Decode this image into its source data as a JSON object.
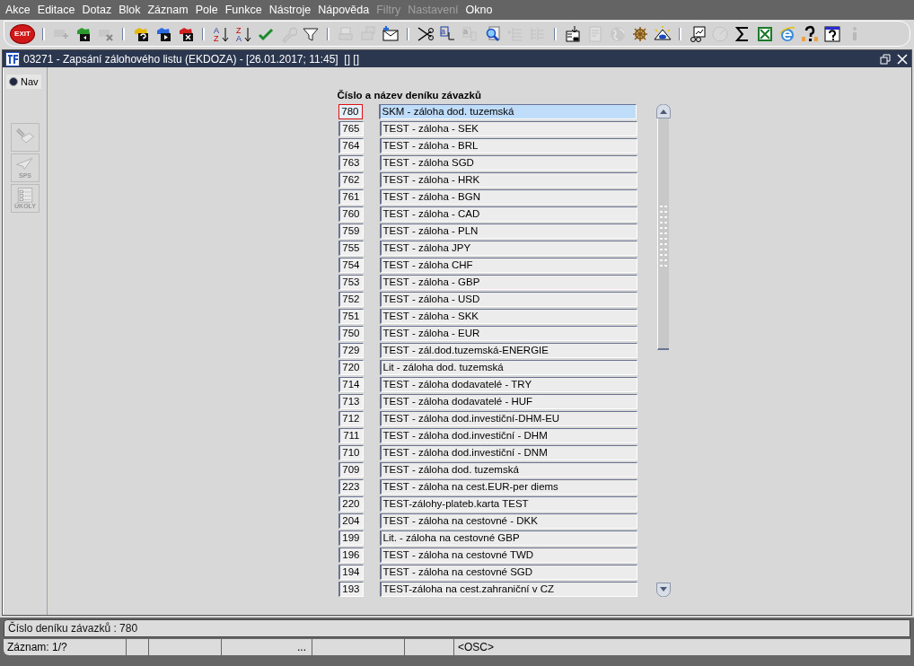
{
  "menu": [
    {
      "label": "Akce",
      "disabled": false
    },
    {
      "label": "Editace",
      "disabled": false
    },
    {
      "label": "Dotaz",
      "disabled": false
    },
    {
      "label": "Blok",
      "disabled": false
    },
    {
      "label": "Záznam",
      "disabled": false
    },
    {
      "label": "Pole",
      "disabled": false
    },
    {
      "label": "Funkce",
      "disabled": false
    },
    {
      "label": "Nástroje",
      "disabled": false
    },
    {
      "label": "Nápověda",
      "disabled": false
    },
    {
      "label": "Filtry",
      "disabled": true
    },
    {
      "label": "Nastavení",
      "disabled": true
    },
    {
      "label": "Okno",
      "disabled": false
    }
  ],
  "toolbar": [
    {
      "kind": "button",
      "disabled": false,
      "label": "EXIT"
    },
    {
      "kind": "separator"
    },
    {
      "kind": "button",
      "disabled": true
    },
    {
      "kind": "button",
      "disabled": false
    },
    {
      "kind": "button",
      "disabled": true
    },
    {
      "kind": "separator"
    },
    {
      "kind": "button",
      "disabled": false
    },
    {
      "kind": "button",
      "disabled": false
    },
    {
      "kind": "button",
      "disabled": false
    },
    {
      "kind": "separator"
    },
    {
      "kind": "button",
      "disabled": false,
      "letters": [
        "A",
        "Z"
      ]
    },
    {
      "kind": "button",
      "disabled": false,
      "letters": [
        "Z",
        "A"
      ]
    },
    {
      "kind": "button",
      "disabled": false
    },
    {
      "kind": "button",
      "disabled": true
    },
    {
      "kind": "button",
      "disabled": false
    },
    {
      "kind": "separator"
    },
    {
      "kind": "button",
      "disabled": true
    },
    {
      "kind": "button",
      "disabled": true
    },
    {
      "kind": "button",
      "disabled": false
    },
    {
      "kind": "separator"
    },
    {
      "kind": "button",
      "disabled": false
    },
    {
      "kind": "button",
      "disabled": false,
      "letters": [
        "a"
      ]
    },
    {
      "kind": "button",
      "disabled": true,
      "letters": [
        "a"
      ]
    },
    {
      "kind": "button",
      "disabled": false
    },
    {
      "kind": "button",
      "disabled": true
    },
    {
      "kind": "button",
      "disabled": true
    },
    {
      "kind": "separator"
    },
    {
      "kind": "button",
      "disabled": false
    },
    {
      "kind": "button",
      "disabled": true
    },
    {
      "kind": "button",
      "disabled": true
    },
    {
      "kind": "button",
      "disabled": false
    },
    {
      "kind": "button",
      "disabled": false
    },
    {
      "kind": "separator"
    },
    {
      "kind": "button",
      "disabled": false
    },
    {
      "kind": "button",
      "disabled": true
    },
    {
      "kind": "button",
      "disabled": false
    },
    {
      "kind": "button",
      "disabled": false
    },
    {
      "kind": "button",
      "disabled": false
    },
    {
      "kind": "button",
      "disabled": false
    },
    {
      "kind": "button",
      "disabled": false
    },
    {
      "kind": "button",
      "disabled": true
    }
  ],
  "window": {
    "title": "03271 - Zapsání zálohového listu (EKDOZA) - [26.01.2017; 11:45]  [] []"
  },
  "sidebar": {
    "radio": {
      "label": "Nav",
      "selected": true
    },
    "buttons": [
      {
        "disabled": true
      },
      {
        "label": "SPS",
        "disabled": true
      },
      {
        "label": "ÚKOLY",
        "disabled": true
      }
    ]
  },
  "table": {
    "heading": "Číslo a název deníku závazků",
    "rows": [
      {
        "number": "780",
        "name": "SKM - záloha dod. tuzemská",
        "selected": true
      },
      {
        "number": "765",
        "name": "TEST - záloha - SEK",
        "selected": false
      },
      {
        "number": "764",
        "name": "TEST - záloha - BRL",
        "selected": false
      },
      {
        "number": "763",
        "name": "TEST - záloha SGD",
        "selected": false
      },
      {
        "number": "762",
        "name": "TEST - záloha - HRK",
        "selected": false
      },
      {
        "number": "761",
        "name": "TEST - záloha - BGN",
        "selected": false
      },
      {
        "number": "760",
        "name": "TEST - záloha - CAD",
        "selected": false
      },
      {
        "number": "759",
        "name": "TEST - záloha - PLN",
        "selected": false
      },
      {
        "number": "755",
        "name": "TEST - záloha JPY",
        "selected": false
      },
      {
        "number": "754",
        "name": "TEST - záloha CHF",
        "selected": false
      },
      {
        "number": "753",
        "name": "TEST - záloha - GBP",
        "selected": false
      },
      {
        "number": "752",
        "name": "TEST - záloha - USD",
        "selected": false
      },
      {
        "number": "751",
        "name": "TEST - záloha - SKK",
        "selected": false
      },
      {
        "number": "750",
        "name": "TEST - záloha - EUR",
        "selected": false
      },
      {
        "number": "729",
        "name": "TEST - zál.dod.tuzemská-ENERGIE",
        "selected": false
      },
      {
        "number": "720",
        "name": "Lit - záloha dod. tuzemská",
        "selected": false
      },
      {
        "number": "714",
        "name": "TEST - záloha dodavatelé - TRY",
        "selected": false
      },
      {
        "number": "713",
        "name": "TEST - záloha dodavatelé - HUF",
        "selected": false
      },
      {
        "number": "712",
        "name": "TEST - záloha dod.investiční-DHM-EU",
        "selected": false
      },
      {
        "number": "711",
        "name": "TEST - záloha dod.investiční - DHM",
        "selected": false
      },
      {
        "number": "710",
        "name": "TEST - záloha dod.investiční - DNM",
        "selected": false
      },
      {
        "number": "709",
        "name": "TEST - záloha dod. tuzemská",
        "selected": false
      },
      {
        "number": "223",
        "name": "TEST - záloha na cest.EUR-per diems",
        "selected": false
      },
      {
        "number": "220",
        "name": "TEST-zálohy-plateb.karta TEST",
        "selected": false
      },
      {
        "number": "204",
        "name": "TEST - záloha na cestovné - DKK",
        "selected": false
      },
      {
        "number": "199",
        "name": "Lit. - záloha na cestovné GBP",
        "selected": false
      },
      {
        "number": "196",
        "name": "TEST - záloha na cestovné TWD",
        "selected": false
      },
      {
        "number": "194",
        "name": "TEST - záloha na cestovné SGD",
        "selected": false
      },
      {
        "number": "193",
        "name": "TEST-záloha na cest.zahraniční v CZ",
        "selected": false
      }
    ]
  },
  "status_bar": {
    "message": "Číslo deníku závazků : 780",
    "cells": [
      "Záznam: 1/?",
      "...",
      "<OSC>"
    ]
  }
}
